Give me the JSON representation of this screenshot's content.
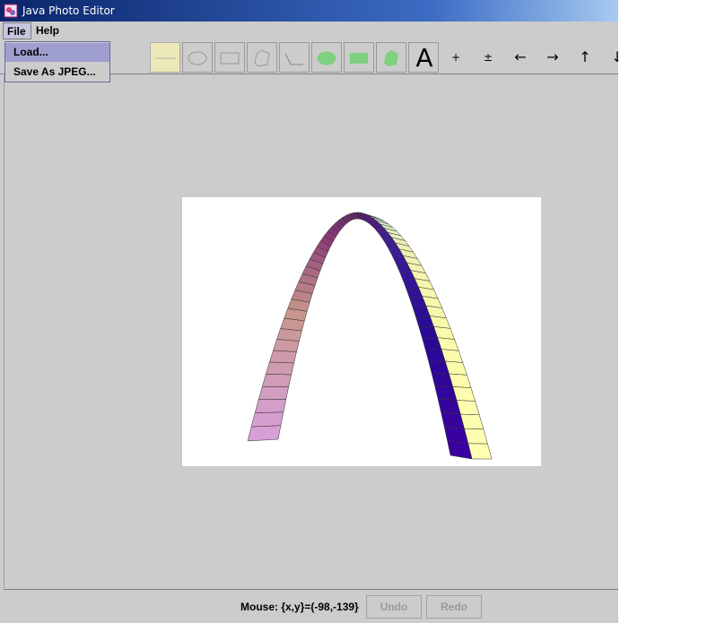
{
  "window": {
    "title": "Java Photo Editor"
  },
  "menubar": {
    "file": "File",
    "help": "Help"
  },
  "file_menu": {
    "items": [
      {
        "label": "Load..."
      },
      {
        "label": "Save As JPEG..."
      }
    ]
  },
  "toolbar": {
    "tools": [
      {
        "name": "line-tool",
        "icon": "line-icon",
        "selected": true
      },
      {
        "name": "oval-tool",
        "icon": "oval-outline-icon"
      },
      {
        "name": "rectangle-tool",
        "icon": "rectangle-outline-icon"
      },
      {
        "name": "freeform-tool",
        "icon": "freeform-outline-icon"
      },
      {
        "name": "curve-tool",
        "icon": "curve-icon"
      },
      {
        "name": "filled-oval-tool",
        "icon": "oval-filled-icon"
      },
      {
        "name": "filled-rectangle-tool",
        "icon": "rectangle-filled-icon"
      },
      {
        "name": "filled-freeform-tool",
        "icon": "freeform-filled-icon"
      }
    ],
    "text_tool": "A",
    "zoom_in": "+",
    "zoom_toggle": "±",
    "move_left": "←",
    "move_right": "→",
    "move_up": "↑",
    "move_down": "↓"
  },
  "colors": {
    "tool_fill": "#7fd07f",
    "tool_stroke": "#999999",
    "selected_tool": "#ede8b8"
  },
  "statusbar": {
    "mouse_label": "Mouse: {x,y}=(-98,-139}",
    "undo": "Undo",
    "redo": "Redo"
  }
}
